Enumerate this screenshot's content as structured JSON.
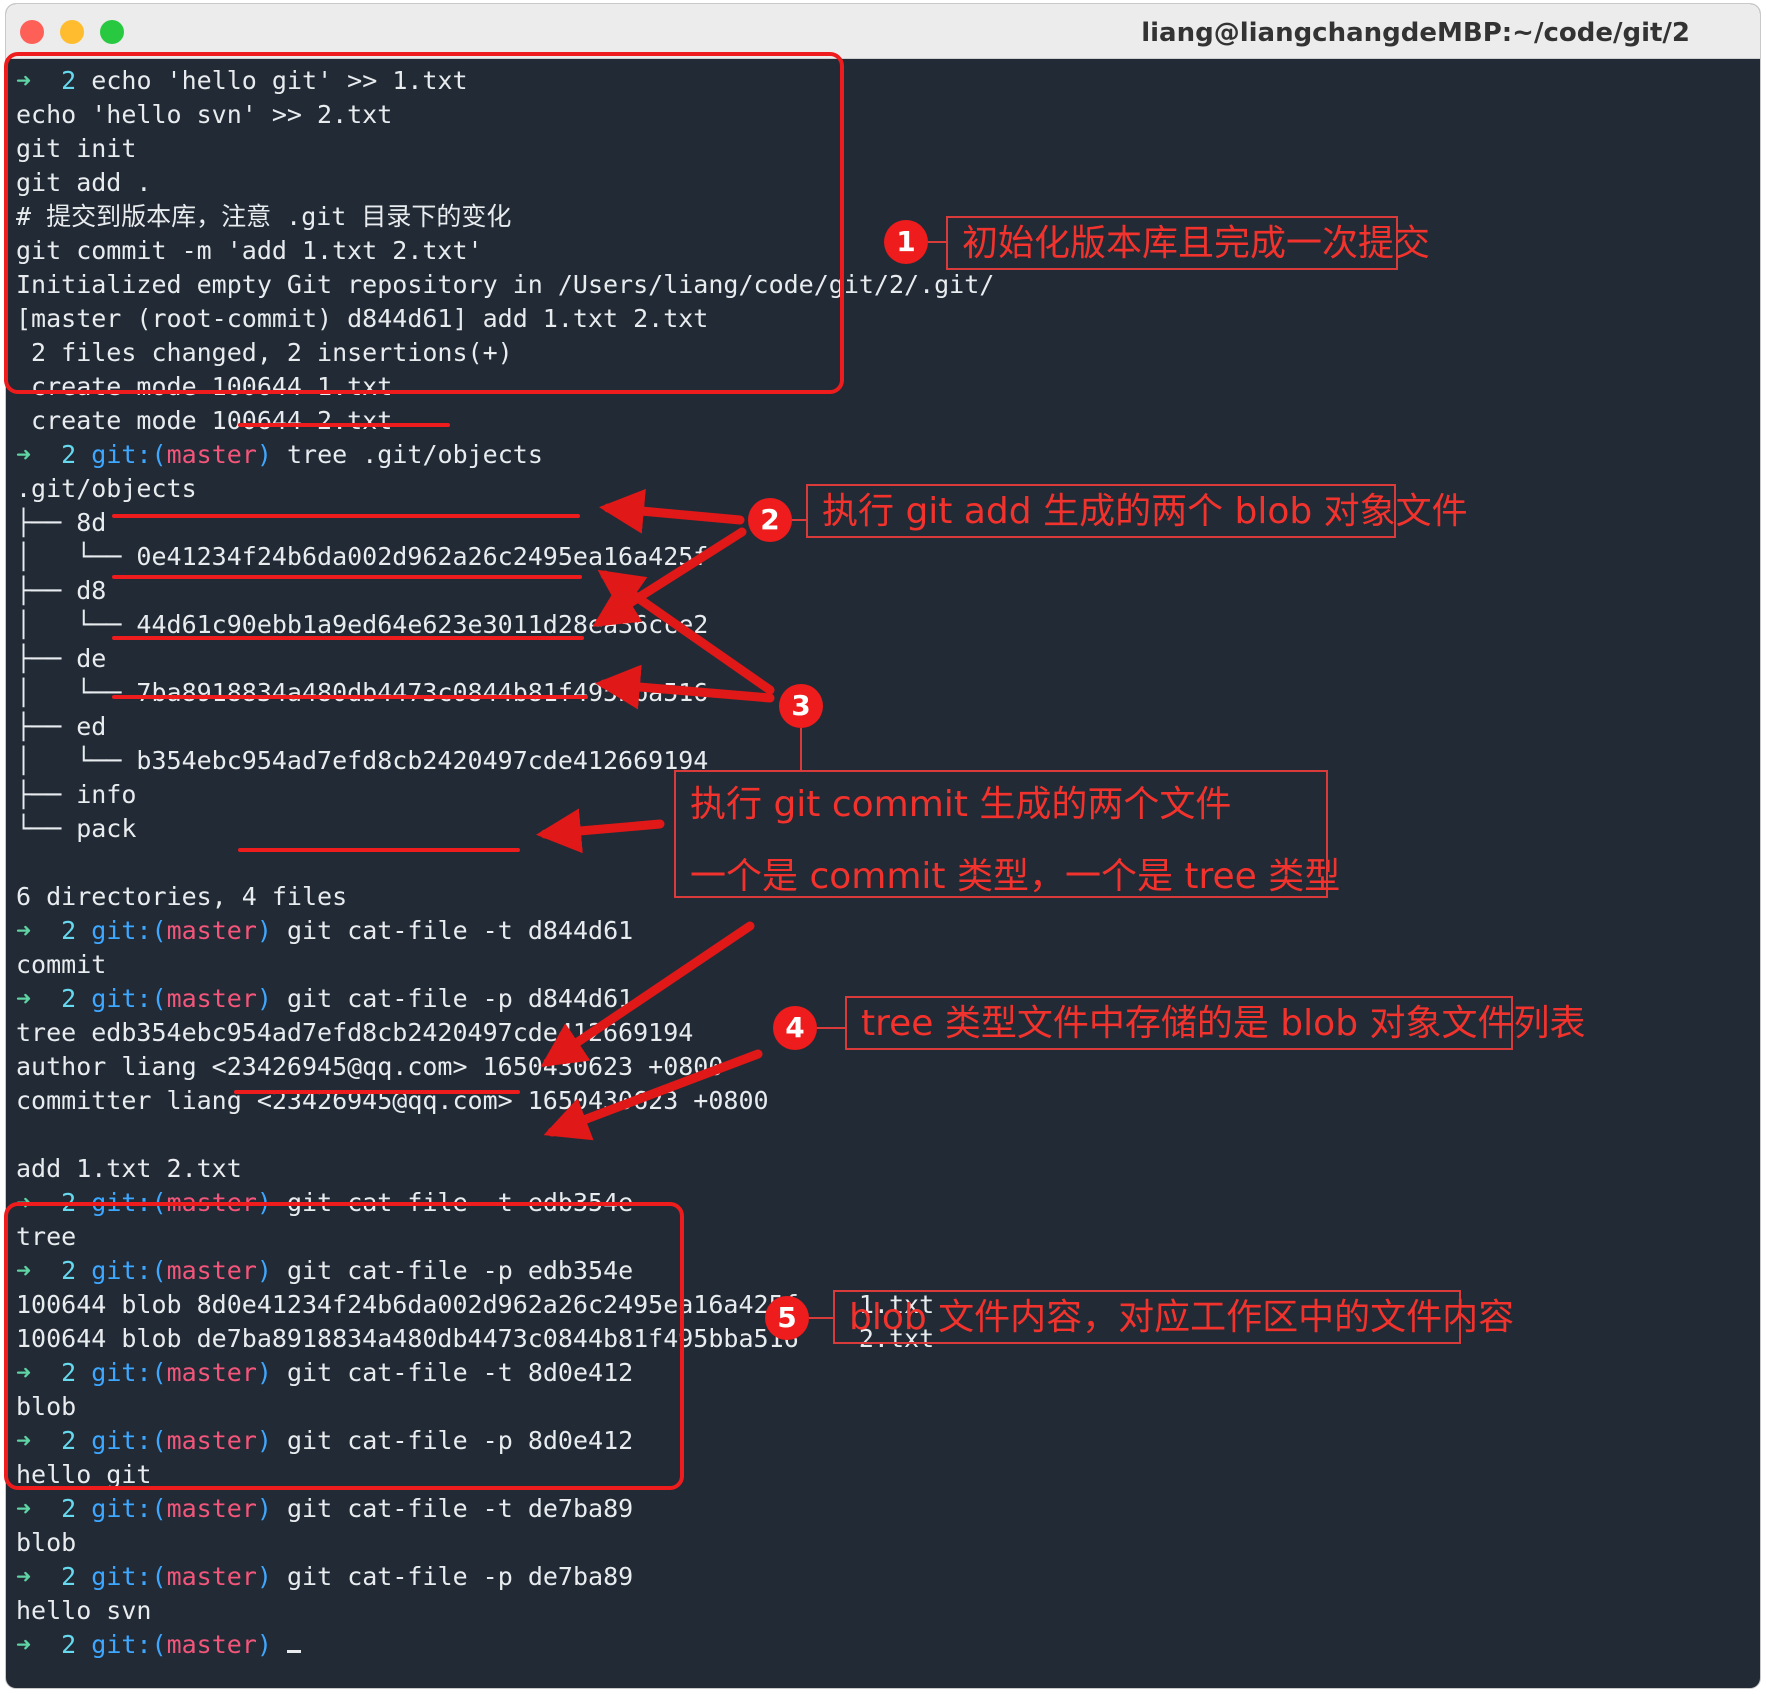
{
  "window": {
    "title": "liang@liangchangdeMBP:~/code/git/2"
  },
  "prompt": {
    "arrow": "➜",
    "dir": "2",
    "git_prefix": "git:(",
    "branch": "master",
    "git_suffix": ")"
  },
  "lines": [
    {
      "type": "cmd",
      "prompt": "bare",
      "text": "echo 'hello git' >> 1.txt"
    },
    {
      "type": "out",
      "text": "echo 'hello svn' >> 2.txt"
    },
    {
      "type": "out",
      "text": "git init"
    },
    {
      "type": "out",
      "text": "git add ."
    },
    {
      "type": "out",
      "text": "# 提交到版本库，注意 .git 目录下的变化"
    },
    {
      "type": "out",
      "text": "git commit -m 'add 1.txt 2.txt'"
    },
    {
      "type": "out",
      "text": "Initialized empty Git repository in /Users/liang/code/git/2/.git/"
    },
    {
      "type": "out",
      "text": "[master (root-commit) d844d61] add 1.txt 2.txt"
    },
    {
      "type": "out",
      "text": " 2 files changed, 2 insertions(+)"
    },
    {
      "type": "out",
      "text": " create mode 100644 1.txt"
    },
    {
      "type": "out",
      "text": " create mode 100644 2.txt"
    },
    {
      "type": "cmd",
      "prompt": "git",
      "text": "tree .git/objects"
    },
    {
      "type": "out",
      "text": ".git/objects"
    },
    {
      "type": "out",
      "text": "├── 8d"
    },
    {
      "type": "out",
      "text": "│   └── 0e41234f24b6da002d962a26c2495ea16a425f"
    },
    {
      "type": "out",
      "text": "├── d8"
    },
    {
      "type": "out",
      "text": "│   └── 44d61c90ebb1a9ed64e623e3011d28ea36cce2"
    },
    {
      "type": "out",
      "text": "├── de"
    },
    {
      "type": "out",
      "text": "│   └── 7ba8918834a480db4473c0844b81f495bba516"
    },
    {
      "type": "out",
      "text": "├── ed"
    },
    {
      "type": "out",
      "text": "│   └── b354ebc954ad7efd8cb2420497cde412669194"
    },
    {
      "type": "out",
      "text": "├── info"
    },
    {
      "type": "out",
      "text": "└── pack"
    },
    {
      "type": "out",
      "text": ""
    },
    {
      "type": "out",
      "text": "6 directories, 4 files"
    },
    {
      "type": "cmd",
      "prompt": "git",
      "text": "git cat-file -t d844d61"
    },
    {
      "type": "out",
      "text": "commit"
    },
    {
      "type": "cmd",
      "prompt": "git",
      "text": "git cat-file -p d844d61"
    },
    {
      "type": "out",
      "text": "tree edb354ebc954ad7efd8cb2420497cde412669194"
    },
    {
      "type": "out",
      "text": "author liang <23426945@qq.com> 1650430623 +0800"
    },
    {
      "type": "out",
      "text": "committer liang <23426945@qq.com> 1650430623 +0800"
    },
    {
      "type": "out",
      "text": ""
    },
    {
      "type": "out",
      "text": "add 1.txt 2.txt"
    },
    {
      "type": "cmd",
      "prompt": "git",
      "text": "git cat-file -t edb354e"
    },
    {
      "type": "out",
      "text": "tree"
    },
    {
      "type": "cmd",
      "prompt": "git",
      "text": "git cat-file -p edb354e"
    },
    {
      "type": "out",
      "text": "100644 blob 8d0e41234f24b6da002d962a26c2495ea16a425f    1.txt"
    },
    {
      "type": "out",
      "text": "100644 blob de7ba8918834a480db4473c0844b81f495bba516    2.txt"
    },
    {
      "type": "cmd",
      "prompt": "git",
      "text": "git cat-file -t 8d0e412"
    },
    {
      "type": "out",
      "text": "blob"
    },
    {
      "type": "cmd",
      "prompt": "git",
      "text": "git cat-file -p 8d0e412"
    },
    {
      "type": "out",
      "text": "hello git"
    },
    {
      "type": "cmd",
      "prompt": "git",
      "text": "git cat-file -t de7ba89"
    },
    {
      "type": "out",
      "text": "blob"
    },
    {
      "type": "cmd",
      "prompt": "git",
      "text": "git cat-file -p de7ba89"
    },
    {
      "type": "out",
      "text": "hello svn"
    },
    {
      "type": "cmd",
      "prompt": "git",
      "text": "",
      "cursor": true
    }
  ],
  "annotations": [
    {
      "num": "1",
      "text": "初始化版本库且完成一次提交"
    },
    {
      "num": "2",
      "text": "执行 git add 生成的两个 blob 对象文件"
    },
    {
      "num": "3",
      "line1": "执行 git commit 生成的两个文件",
      "line2": "一个是 commit 类型，一个是 tree 类型"
    },
    {
      "num": "4",
      "text": "tree 类型文件中存储的是 blob 对象文件列表"
    },
    {
      "num": "5",
      "text": "blob 文件内容，对应工作区中的文件内容"
    }
  ],
  "colors": {
    "background": "#222a35",
    "annotation_red": "#ee1c1c",
    "arrow_green": "#5fd3a3",
    "git_blue": "#3ea7ff",
    "branch_pink": "#f4557a"
  }
}
